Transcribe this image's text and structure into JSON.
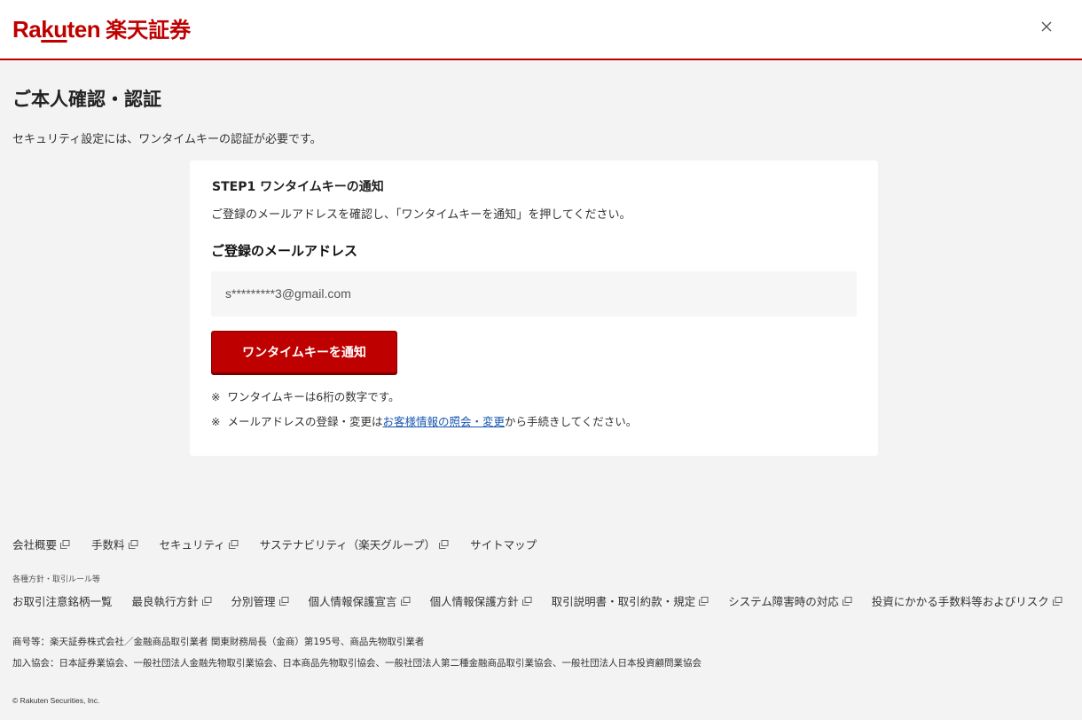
{
  "header": {
    "logo_en_ra": "Ra",
    "logo_en_ku": "ku",
    "logo_en_ten": "ten",
    "logo_jp": "楽天証券",
    "close_icon": "close-icon",
    "brand_color": "#bf0000"
  },
  "page": {
    "title": "ご本人確認・認証",
    "description": "セキュリティ設定には、ワンタイムキーの認証が必要です。"
  },
  "card": {
    "step_title": "STEP1 ワンタイムキーの通知",
    "step_desc": "ご登録のメールアドレスを確認し、「ワンタイムキーを通知」を押してください。",
    "email_label": "ご登録のメールアドレス",
    "email_value": "s*********3@gmail.com",
    "notify_button": "ワンタイムキーを通知",
    "note_mark": "※",
    "note1": "ワンタイムキーは6桁の数字です。",
    "note2_prefix": "メールアドレスの登録・変更は",
    "note2_link": "お客様情報の照会・変更",
    "note2_suffix": "から手続きしてください。"
  },
  "footer": {
    "links": [
      "会社概要",
      "手数料",
      "セキュリティ",
      "サステナビリティ（楽天グループ）",
      "サイトマップ"
    ],
    "rules_heading": "各種方針・取引ルール等",
    "rules_links": [
      "お取引注意銘柄一覧",
      "最良執行方針",
      "分別管理",
      "個人情報保護宣言",
      "個人情報保護方針",
      "取引説明書・取引約款・規定",
      "システム障害時の対応",
      "投資にかかる手数料等およびリスク"
    ],
    "legal1": "商号等：楽天証券株式会社／金融商品取引業者 関東財務局長（金商）第195号、商品先物取引業者",
    "legal2": "加入協会：日本証券業協会、一般社団法人金融先物取引業協会、日本商品先物取引協会、一般社団法人第二種金融商品取引業協会、一般社団法人日本投資顧問業協会",
    "copyright": "© Rakuten Securities, Inc."
  }
}
